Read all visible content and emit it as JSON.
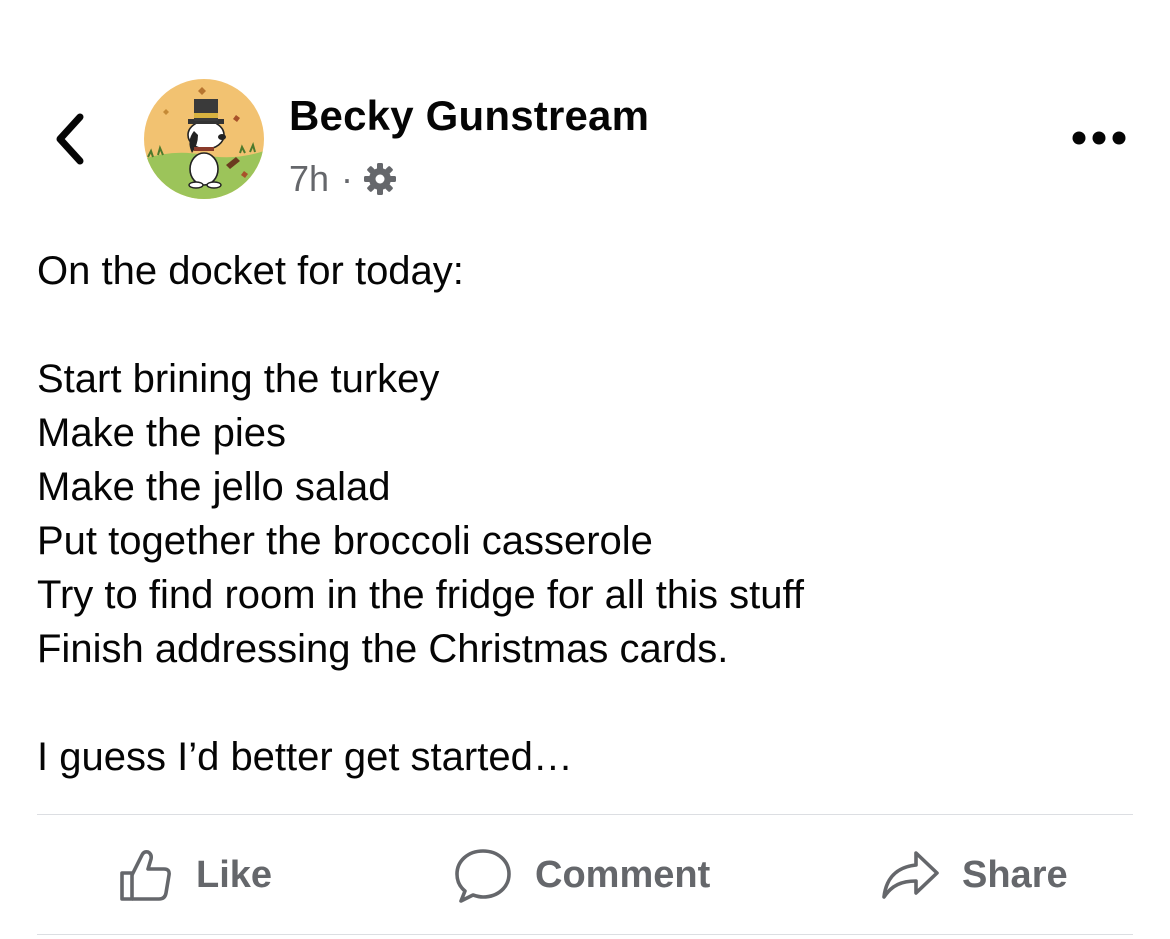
{
  "post": {
    "author": "Becky Gunstream",
    "time": "7h",
    "separator": "·",
    "lines": [
      "On the docket for today:",
      "",
      "Start brining the turkey",
      "Make the pies",
      "Make the jello salad",
      "Put together the broccoli casserole",
      "Try to find room in the fridge for all this stuff",
      "Finish addressing the Christmas cards.",
      "",
      "I guess I’d better get started…"
    ]
  },
  "actions": {
    "like_label": "Like",
    "comment_label": "Comment",
    "share_label": "Share"
  },
  "icons": {
    "back": "chevron-left-icon",
    "more": "more-horizontal-icon",
    "privacy": "gear-icon",
    "like": "thumbs-up-icon",
    "comment": "speech-bubble-icon",
    "share": "share-arrow-icon"
  },
  "colors": {
    "text": "#050505",
    "secondary": "#65676b",
    "divider": "#dcdee2",
    "avatar_background": "#f2c271"
  }
}
